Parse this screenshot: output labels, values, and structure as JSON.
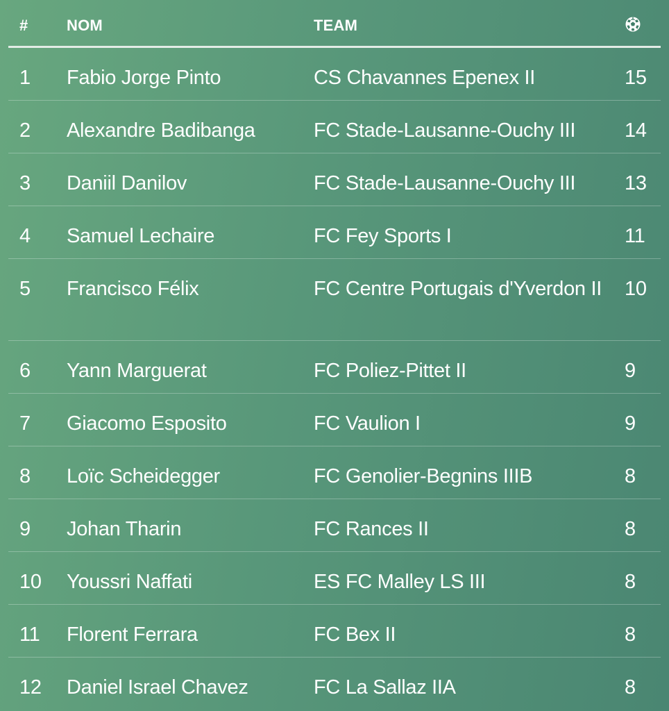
{
  "table": {
    "headers": {
      "rank": "#",
      "name": "NOM",
      "team": "TEAM",
      "goals_icon": "soccer-ball-icon"
    },
    "rows": [
      {
        "rank": "1",
        "name": "Fabio Jorge Pinto",
        "team": "CS Chavannes Epenex II",
        "goals": "15"
      },
      {
        "rank": "2",
        "name": "Alexandre Badibanga",
        "team": "FC Stade-Lausanne-Ouchy III",
        "goals": "14"
      },
      {
        "rank": "3",
        "name": "Daniil Danilov",
        "team": "FC Stade-Lausanne-Ouchy III",
        "goals": "13"
      },
      {
        "rank": "4",
        "name": "Samuel Lechaire",
        "team": "FC Fey Sports I",
        "goals": "11"
      },
      {
        "rank": "5",
        "name": "Francisco Félix",
        "team": "FC Centre Portugais d'Yverdon II",
        "goals": "10"
      },
      {
        "rank": "6",
        "name": "Yann Marguerat",
        "team": "FC Poliez-Pittet II",
        "goals": "9"
      },
      {
        "rank": "7",
        "name": "Giacomo Esposito",
        "team": "FC Vaulion I",
        "goals": "9"
      },
      {
        "rank": "8",
        "name": "Loïc Scheidegger",
        "team": "FC Genolier-Begnins IIIB",
        "goals": "8"
      },
      {
        "rank": "9",
        "name": "Johan Tharin",
        "team": "FC Rances II",
        "goals": "8"
      },
      {
        "rank": "10",
        "name": "Youssri Naffati",
        "team": "ES FC Malley LS III",
        "goals": "8"
      },
      {
        "rank": "11",
        "name": "Florent Ferrara",
        "team": "FC Bex II",
        "goals": "8"
      },
      {
        "rank": "12",
        "name": "Daniel Israel Chavez",
        "team": "FC La Sallaz IIA",
        "goals": "8"
      }
    ]
  },
  "colors": {
    "background_start": "#68a77f",
    "background_end": "#4a8672",
    "text": "#ffffff"
  }
}
